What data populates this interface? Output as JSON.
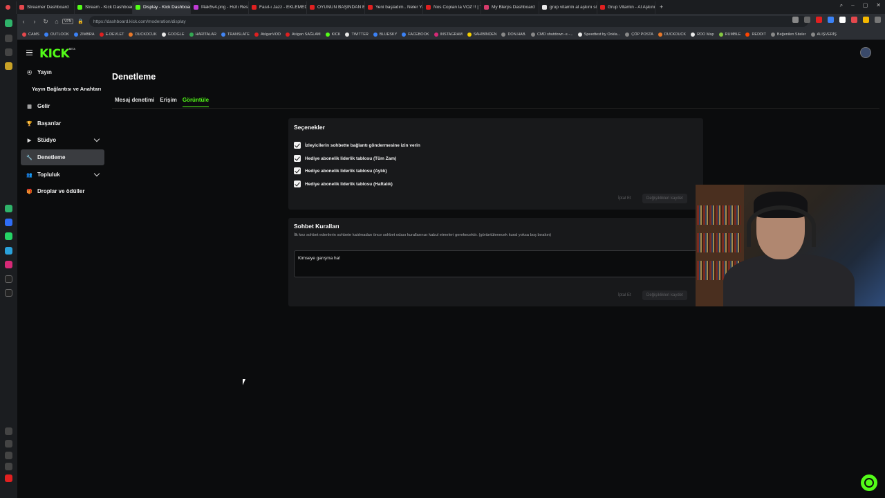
{
  "browser": {
    "tabs": [
      {
        "label": "Streamer Dashboard",
        "color": "#e5484d"
      },
      {
        "label": "Stream - Kick Dashboard",
        "color": "#53fc18"
      },
      {
        "label": "Display - Kick Dashboard",
        "color": "#53fc18",
        "active": true
      },
      {
        "label": "f4ak5v4.png - Hızlı Resim",
        "color": "#c03bd6"
      },
      {
        "label": "Fasıl-ı Jazz - EKLEMEDİR",
        "color": "#e02020"
      },
      {
        "label": "OYUNUN BAŞINDAN BE...",
        "color": "#e02020"
      },
      {
        "label": "Yeni başladım.. Neler Yapm",
        "color": "#e02020"
      },
      {
        "label": "Nos Copian la VOZ !! | The",
        "color": "#e02020"
      },
      {
        "label": "My Blerps Dashboard",
        "color": "#d63b6b"
      },
      {
        "label": "grup vitamin al aşkını söl",
        "color": "#e8e8e8"
      },
      {
        "label": "Grup Vitamin - Al Aşkını S",
        "color": "#e02020"
      }
    ],
    "url": "https://dashboard.kick.com/moderation/display",
    "vpn_label": "VPN",
    "bookmarks": [
      {
        "label": "CAMS",
        "color": "#e5484d"
      },
      {
        "label": "OUTLOOK",
        "color": "#3b82f6"
      },
      {
        "label": "ZIMBRA",
        "color": "#3b82f6"
      },
      {
        "label": "E-DEVLET",
        "color": "#e02020"
      },
      {
        "label": "DUCKDCUK",
        "color": "#e8792a"
      },
      {
        "label": "GOOGLE",
        "color": "#e8e8e8"
      },
      {
        "label": "HARİTALAR",
        "color": "#34a853"
      },
      {
        "label": "TRANSLATE",
        "color": "#4285f4"
      },
      {
        "label": "AtılganVOD",
        "color": "#e02020"
      },
      {
        "label": "Atılgan SAĞLAM",
        "color": "#e02020"
      },
      {
        "label": "KICK",
        "color": "#53fc18"
      },
      {
        "label": "TWITTER",
        "color": "#e8e8e8"
      },
      {
        "label": "BLUESKY",
        "color": "#3b82f6"
      },
      {
        "label": "FACEBOOK",
        "color": "#3b82f6"
      },
      {
        "label": "INSTAGRAM",
        "color": "#d62976"
      },
      {
        "label": "SAHİBİNDEN",
        "color": "#f5d000"
      },
      {
        "label": "DON.HAB.",
        "color": "#888888"
      },
      {
        "label": "CMD shutdown -s -...",
        "color": "#888888"
      },
      {
        "label": "Speedtest by Ookla...",
        "color": "#e8e8e8"
      },
      {
        "label": "ÇÖP POSTA",
        "color": "#888888"
      },
      {
        "label": "DUCKDUCK",
        "color": "#e8792a"
      },
      {
        "label": "RDO Map",
        "color": "#e8e8e8"
      },
      {
        "label": "RUMBLE",
        "color": "#85c742"
      },
      {
        "label": "REDDIT",
        "color": "#ff4500"
      },
      {
        "label": "Beğenilen Siteler",
        "color": "#888888"
      },
      {
        "label": "ALIŞVERİŞ",
        "color": "#888888"
      }
    ]
  },
  "kick": {
    "logo": "KICK",
    "logo_badge": "BETA",
    "brand_color": "#53fc18",
    "sidebar": [
      {
        "label": "Yayın",
        "icon": "broadcast-icon"
      },
      {
        "label": "Yayın Bağlantısı ve Anahtarı",
        "icon": ""
      },
      {
        "label": "Gelir",
        "icon": "chart-icon"
      },
      {
        "label": "Başarılar",
        "icon": "trophy-icon"
      },
      {
        "label": "Stüdyo",
        "icon": "studio-icon",
        "expandable": true
      },
      {
        "label": "Denetleme",
        "icon": "wrench-icon",
        "active": true
      },
      {
        "label": "Topluluk",
        "icon": "community-icon",
        "expandable": true
      },
      {
        "label": "Droplar ve ödüller",
        "icon": "gift-icon"
      }
    ],
    "page_title": "Denetleme",
    "tabs": [
      {
        "label": "Mesaj denetimi"
      },
      {
        "label": "Erişim"
      },
      {
        "label": "Görüntüle",
        "active": true
      }
    ],
    "options": {
      "title": "Seçenekler",
      "checkboxes": [
        {
          "label": "İzleyicilerin sohbette bağlantı göndermesine izin verin",
          "checked": true
        },
        {
          "label": "Hediye abonelik liderlik tablosu (Tüm Zam)",
          "checked": true
        },
        {
          "label": "Hediye abonelik liderlik tablosu (Aylık)",
          "checked": true
        },
        {
          "label": "Hediye abonelik liderlik tablosu (Haftalık)",
          "checked": true
        }
      ],
      "cancel_label": "İptal Et",
      "save_label": "Değişiklikleri kaydet"
    },
    "rules": {
      "title": "Sohbet Kuralları",
      "description": "İlk kez sohbet edenlerin sohbete katılmadan önce sohbet odası kurallarınızı kabul etmeleri gerekecektir. (görüntülenecek kural yoksa boş bırakın)",
      "value": "Kimseye garışma ha!",
      "cancel_label": "İptal Et",
      "save_label": "Değişiklikleri kaydet"
    }
  }
}
